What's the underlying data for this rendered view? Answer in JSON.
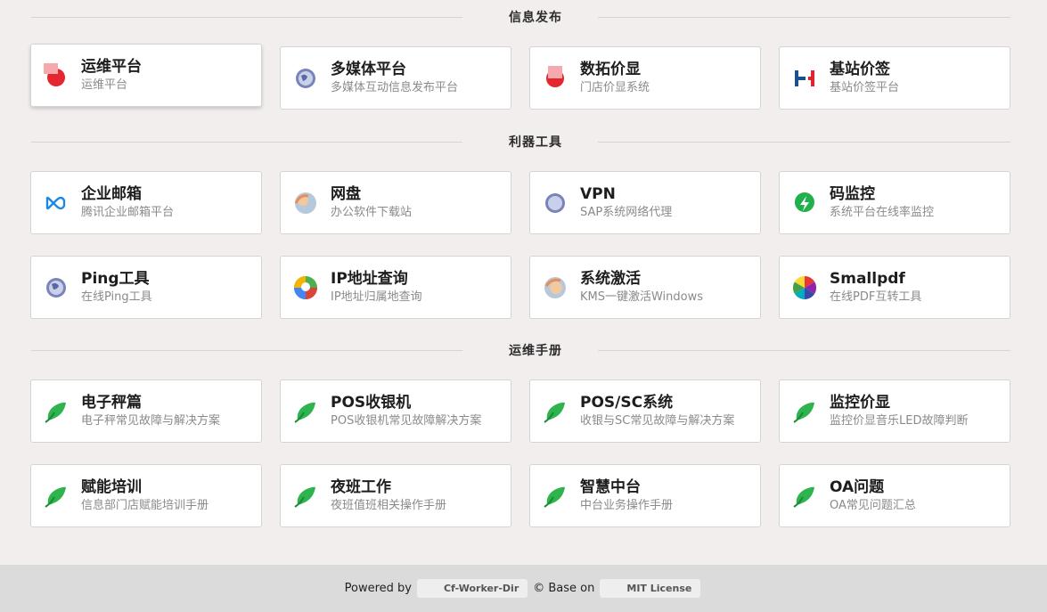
{
  "sections": [
    {
      "title": "信息发布"
    },
    {
      "title": "利器工具"
    },
    {
      "title": "运维手册"
    }
  ],
  "cards": [
    {
      "name": "运维平台",
      "desc": "运维平台",
      "icon": "red-dot-icon"
    },
    {
      "name": "多媒体平台",
      "desc": "多媒体互动信息发布平台",
      "icon": "globe-icon"
    },
    {
      "name": "数拓价显",
      "desc": "门店价显系统",
      "icon": "red-dot-icon"
    },
    {
      "name": "基站价签",
      "desc": "基站价签平台",
      "icon": "h-logo-icon"
    },
    {
      "name": "企业邮箱",
      "desc": "腾讯企业邮箱平台",
      "icon": "infinity-icon"
    },
    {
      "name": "网盘",
      "desc": "办公软件下载站",
      "icon": "avatar-icon"
    },
    {
      "name": "VPN",
      "desc": "SAP系统网络代理",
      "icon": "globe-icon"
    },
    {
      "name": "码监控",
      "desc": "系统平台在线率监控",
      "icon": "bolt-icon"
    },
    {
      "name": "Ping工具",
      "desc": "在线Ping工具",
      "icon": "globe-icon"
    },
    {
      "name": "IP地址查询",
      "desc": "IP地址归属地查询",
      "icon": "map-pin-icon"
    },
    {
      "name": "系统激活",
      "desc": "KMS一键激活Windows",
      "icon": "avatar-icon"
    },
    {
      "name": "Smallpdf",
      "desc": "在线PDF互转工具",
      "icon": "color-wheel-icon"
    },
    {
      "name": "电子秤篇",
      "desc": "电子秤常见故障与解决方案",
      "icon": "leaf-icon"
    },
    {
      "name": "POS收银机",
      "desc": "POS收银机常见故障解决方案",
      "icon": "leaf-icon"
    },
    {
      "name": "POS/SC系统",
      "desc": "收银与SC常见故障与解决方案",
      "icon": "leaf-icon"
    },
    {
      "name": "监控价显",
      "desc": "监控价显音乐LED故障判断",
      "icon": "leaf-icon"
    },
    {
      "name": "赋能培训",
      "desc": "信息部门店赋能培训手册",
      "icon": "leaf-icon"
    },
    {
      "name": "夜班工作",
      "desc": "夜班值班相关操作手册",
      "icon": "leaf-icon"
    },
    {
      "name": "智慧中台",
      "desc": "中台业务操作手册",
      "icon": "leaf-icon"
    },
    {
      "name": "OA问题",
      "desc": "OA常见问题汇总",
      "icon": "leaf-icon"
    }
  ],
  "footer": {
    "powered_by": "Powered by",
    "project": "Cf-Worker-Dir",
    "base_on": "© Base on",
    "license": "MIT License"
  }
}
